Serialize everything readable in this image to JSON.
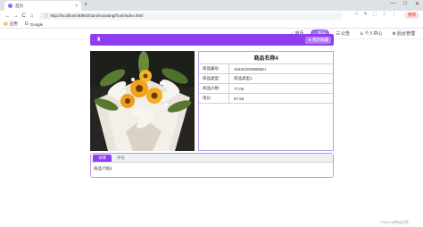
{
  "browser": {
    "tab_title": "首页",
    "tab_close": "×",
    "new_tab": "+",
    "window_controls": [
      "—",
      "□",
      "✕"
    ],
    "nav_back": "←",
    "nav_forward": "→",
    "nav_reload": "C",
    "nav_home": "⌂",
    "lock": "ⓘ",
    "url": "http://localhost:8080/zhanchouwang/front/index.html",
    "extension_icons": [
      "☆",
      "✎",
      "⬚",
      "☆",
      "⋮"
    ],
    "update_label": "更新",
    "bookmarks": [
      {
        "icon": "▦",
        "label": "应用"
      },
      {
        "icon": "G",
        "label": "Google"
      }
    ]
  },
  "site_nav": [
    {
      "icon": "⌂",
      "label": "首页",
      "active": false
    },
    {
      "icon": "⌂",
      "label": "商品",
      "active": true
    },
    {
      "icon": "☷",
      "label": "公告",
      "active": false
    },
    {
      "icon": "♙",
      "label": "个人中心",
      "active": false
    },
    {
      "icon": "⚙",
      "label": "后台管理",
      "active": false
    }
  ],
  "banner": {
    "icon": "♜",
    "favorite_label": "我的收藏",
    "favorite_icon": "★"
  },
  "product": {
    "image_alt": "flower-bouquet",
    "title": "商品名称4",
    "rows": [
      {
        "label": "商品编号:",
        "value": "1648220098896H"
      },
      {
        "label": "商品类型:",
        "value": "商品类型1"
      },
      {
        "label": "商品价格:",
        "value": "77.06"
      },
      {
        "label": "现价:",
        "value": "87.53"
      }
    ]
  },
  "detail_tabs": [
    {
      "label": "详情",
      "active": true
    },
    {
      "label": "评论",
      "active": false
    }
  ],
  "detail_content": "商品介绍4",
  "watermark": "CSDN @神仙百草",
  "colors": {
    "accent": "#8f3df0",
    "border": "#b898ee",
    "nav_active": "#9b6cf2"
  }
}
